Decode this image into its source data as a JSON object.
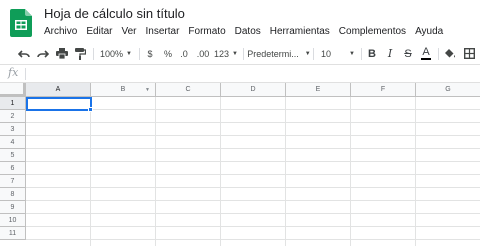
{
  "document": {
    "title": "Hoja de cálculo sin título"
  },
  "menu": [
    "Archivo",
    "Editar",
    "Ver",
    "Insertar",
    "Formato",
    "Datos",
    "Herramientas",
    "Complementos",
    "Ayuda"
  ],
  "toolbar": {
    "zoom": "100%",
    "currency": "$",
    "percent": "%",
    "decrease_decimals": ".0",
    "increase_decimals": ".00",
    "more_formats": "123",
    "font": "Predetermi...",
    "font_size": "10",
    "bold": "B",
    "italic": "I",
    "strikethrough": "S",
    "text_color": "A"
  },
  "formula_bar": {
    "fx_label": "fx",
    "value": ""
  },
  "grid": {
    "columns": [
      "A",
      "B",
      "C",
      "D",
      "E",
      "F",
      "G"
    ],
    "rows": [
      "1",
      "2",
      "3",
      "4",
      "5",
      "6",
      "7",
      "8",
      "9",
      "10",
      "11"
    ],
    "active_cell": "A1"
  },
  "colors": {
    "brand_green": "#0f9d58",
    "selection_blue": "#1a73e8"
  }
}
